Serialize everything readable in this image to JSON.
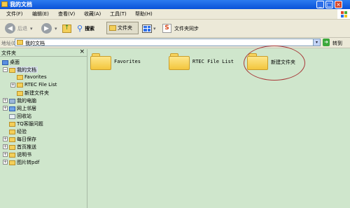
{
  "window": {
    "title": "我的文档"
  },
  "menu": {
    "items": [
      "文件(F)",
      "编辑(E)",
      "查看(V)",
      "收藏(A)",
      "工具(T)",
      "帮助(H)"
    ]
  },
  "toolbar": {
    "back": "后退",
    "search": "搜索",
    "folders": "文件夹",
    "sync": "文件夹同步"
  },
  "address": {
    "label": "地址(D)",
    "value": "我的文档",
    "go": "转到"
  },
  "leftpane": {
    "title": "文件夹",
    "tree": [
      "桌面",
      "我的文档",
      "Favorites",
      "RTEC File List",
      "新建文件夹",
      "我的电脑",
      "网上邻居",
      "回收站",
      "TQ客服问题",
      "经验",
      "每日保存",
      "首页推送",
      "说明书",
      "图片转pdf"
    ]
  },
  "content": {
    "items": [
      "Favorites",
      "RTEC File List",
      "新建文件夹"
    ]
  },
  "colors": {
    "titlebar": "#0a52d8",
    "content_bg": "#cfe6cc",
    "highlight_ellipse": "#a83a3a"
  }
}
